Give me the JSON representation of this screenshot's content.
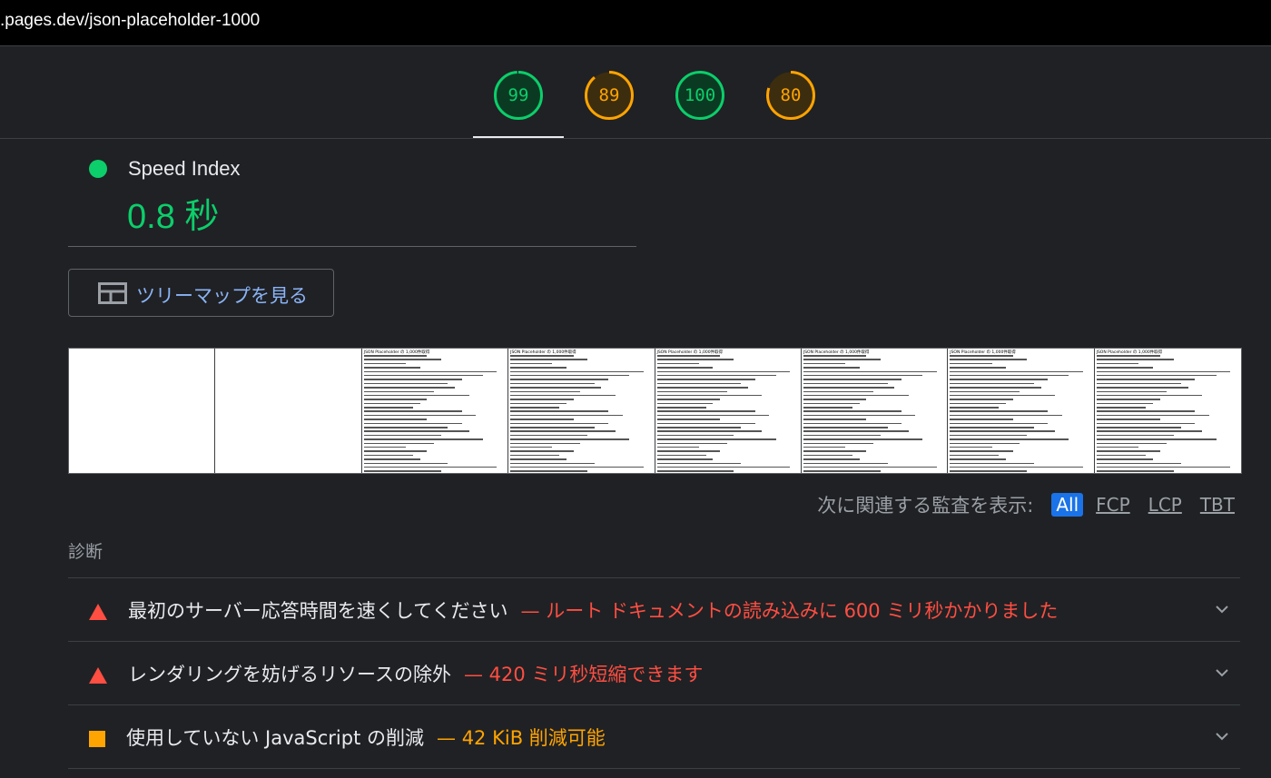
{
  "browser": {
    "url": ".pages.dev/json-placeholder-1000"
  },
  "scores": [
    {
      "value": "99",
      "percent": 99,
      "color": "#0cce6b",
      "bg": "#0a3b22"
    },
    {
      "value": "89",
      "percent": 89,
      "color": "#ffa400",
      "bg": "#3d2d0f"
    },
    {
      "value": "100",
      "percent": 100,
      "color": "#0cce6b",
      "bg": "#0a3b22"
    },
    {
      "value": "80",
      "percent": 80,
      "color": "#ffa400",
      "bg": "#3d2d0f"
    }
  ],
  "metric": {
    "title": "Speed Index",
    "value": "0.8 秒",
    "status_color": "#0cce6b"
  },
  "treemap": {
    "label": "ツリーマップを見る",
    "icon": "treemap-icon"
  },
  "filmstrip": {
    "frame_title": "JSON Placeholder の 1,000件取得",
    "frames": [
      {
        "blank": true
      },
      {
        "blank": true
      },
      {
        "blank": false
      },
      {
        "blank": false
      },
      {
        "blank": false
      },
      {
        "blank": false
      },
      {
        "blank": false
      },
      {
        "blank": false
      }
    ]
  },
  "filter": {
    "label": "次に関連する監査を表示:",
    "options": [
      "All",
      "FCP",
      "LCP",
      "TBT"
    ],
    "selected": "All"
  },
  "diagnostics": {
    "title": "診断",
    "items": [
      {
        "icon": "fail-triangle-icon",
        "title": "最初のサーバー応答時間を速くしてください",
        "separator": "—",
        "detail": "ルート ドキュメントの読み込みに 600 ミリ秒かかりました",
        "color": "#ff4e42"
      },
      {
        "icon": "fail-triangle-icon",
        "title": "レンダリングを妨げるリソースの除外",
        "separator": "—",
        "detail": "420 ミリ秒短縮できます",
        "color": "#ff4e42"
      },
      {
        "icon": "average-square-icon",
        "title": "使用していない JavaScript の削減",
        "separator": "—",
        "detail": "42 KiB 削減可能",
        "color": "#ffa400"
      }
    ]
  }
}
